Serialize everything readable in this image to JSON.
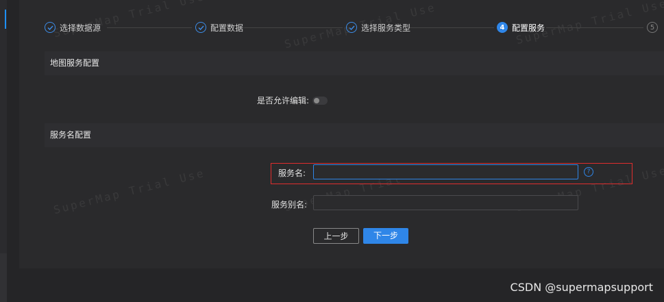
{
  "steps": [
    {
      "label": "选择数据源",
      "state": "done"
    },
    {
      "label": "配置数据",
      "state": "done"
    },
    {
      "label": "选择服务类型",
      "state": "done"
    },
    {
      "label": "配置服务",
      "state": "active",
      "number": "4"
    },
    {
      "label": "5",
      "state": "pending",
      "number": "5"
    }
  ],
  "map_service": {
    "header": "地图服务配置",
    "allow_edit_label": "是否允许编辑:",
    "allow_edit_value": false
  },
  "service_name": {
    "header": "服务名配置",
    "name_label": "服务名:",
    "name_value": "",
    "alias_label": "服务别名:",
    "alias_value": "",
    "help_icon": "?"
  },
  "buttons": {
    "prev": "上一步",
    "next": "下一步"
  },
  "watermark": "SuperMap Trial Use",
  "credit": "CSDN @supermapsupport",
  "colors": {
    "accent": "#2f86e8",
    "highlight_box": "#e12d2d",
    "background": "#252527"
  }
}
